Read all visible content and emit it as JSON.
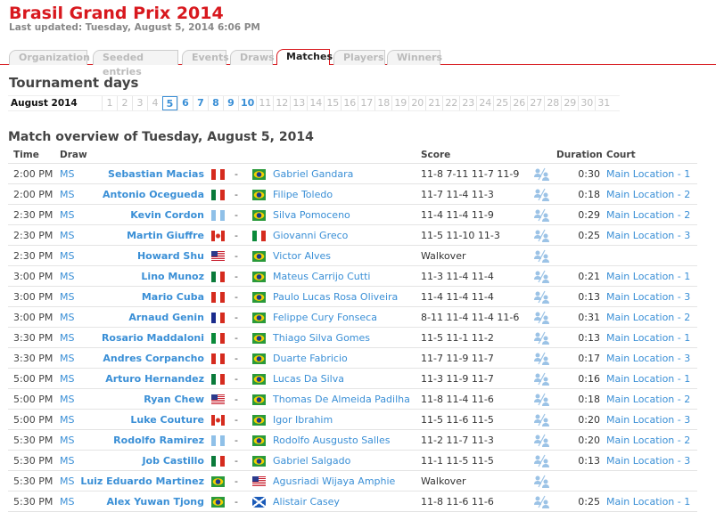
{
  "header": {
    "title": "Brasil Grand Prix 2014",
    "last_updated": "Last updated: Tuesday, August 5, 2014 6:06 PM"
  },
  "tabs": [
    {
      "label": "Organization"
    },
    {
      "label": "Seeded entries"
    },
    {
      "label": "Events"
    },
    {
      "label": "Draws"
    },
    {
      "label": "Matches",
      "active": true
    },
    {
      "label": "Players"
    },
    {
      "label": "Winners"
    }
  ],
  "days": {
    "heading": "Tournament days",
    "month": "August 2014",
    "selected": 5,
    "linked": [
      6,
      7,
      8,
      9,
      10
    ],
    "count": 31
  },
  "overview": {
    "heading": "Match overview of Tuesday, August 5, 2014",
    "columns": {
      "time": "Time",
      "draw": "Draw",
      "score": "Score",
      "duration": "Duration",
      "court": "Court"
    },
    "matches": [
      {
        "time": "2:00 PM",
        "draw": "MS",
        "p1": "Sebastian Macias",
        "f1": "pe",
        "p2": "Gabriel Gandara",
        "f2": "br",
        "score": "11-8 7-11 11-7 11-9",
        "duration": "0:30",
        "court": "Main Location - 1"
      },
      {
        "time": "2:00 PM",
        "draw": "MS",
        "p1": "Antonio Ocegueda",
        "f1": "mx",
        "p2": "Filipe Toledo",
        "f2": "br",
        "score": "11-7 11-4 11-3",
        "duration": "0:18",
        "court": "Main Location - 2"
      },
      {
        "time": "2:30 PM",
        "draw": "MS",
        "p1": "Kevin Cordon",
        "f1": "gt",
        "p2": "Silva Pomoceno",
        "f2": "br",
        "score": "11-4 11-4 11-9",
        "duration": "0:29",
        "court": "Main Location - 2"
      },
      {
        "time": "2:30 PM",
        "draw": "MS",
        "p1": "Martin Giuffre",
        "f1": "ca",
        "p2": "Giovanni Greco",
        "f2": "it",
        "score": "11-5 11-10 11-3",
        "duration": "0:25",
        "court": "Main Location - 3"
      },
      {
        "time": "2:30 PM",
        "draw": "MS",
        "p1": "Howard Shu",
        "f1": "us",
        "p2": "Victor Alves",
        "f2": "br",
        "score": "Walkover",
        "duration": "",
        "court": ""
      },
      {
        "time": "3:00 PM",
        "draw": "MS",
        "p1": "Lino Munoz",
        "f1": "mx",
        "p2": "Mateus Carrijo Cutti",
        "f2": "br",
        "score": "11-3 11-4 11-4",
        "duration": "0:21",
        "court": "Main Location - 1"
      },
      {
        "time": "3:00 PM",
        "draw": "MS",
        "p1": "Mario Cuba",
        "f1": "pe",
        "p2": "Paulo Lucas Rosa Oliveira",
        "f2": "br",
        "score": "11-4 11-4 11-4",
        "duration": "0:13",
        "court": "Main Location - 3"
      },
      {
        "time": "3:00 PM",
        "draw": "MS",
        "p1": "Arnaud Genin",
        "f1": "fr",
        "p2": "Felippe Cury Fonseca",
        "f2": "br",
        "score": "8-11 11-4 11-4 11-6",
        "duration": "0:31",
        "court": "Main Location - 2"
      },
      {
        "time": "3:30 PM",
        "draw": "MS",
        "p1": "Rosario Maddaloni",
        "f1": "it",
        "p2": "Thiago Silva Gomes",
        "f2": "br",
        "score": "11-5 11-1 11-2",
        "duration": "0:13",
        "court": "Main Location - 1"
      },
      {
        "time": "3:30 PM",
        "draw": "MS",
        "p1": "Andres Corpancho",
        "f1": "pe",
        "p2": "Duarte Fabricio",
        "f2": "br",
        "score": "11-7 11-9 11-7",
        "duration": "0:17",
        "court": "Main Location - 3"
      },
      {
        "time": "5:00 PM",
        "draw": "MS",
        "p1": "Arturo Hernandez",
        "f1": "mx",
        "p2": "Lucas Da Silva",
        "f2": "br",
        "score": "11-3 11-9 11-7",
        "duration": "0:16",
        "court": "Main Location - 1"
      },
      {
        "time": "5:00 PM",
        "draw": "MS",
        "p1": "Ryan Chew",
        "f1": "us",
        "p2": "Thomas De Almeida Padilha",
        "f2": "br",
        "score": "11-8 11-4 11-6",
        "duration": "0:18",
        "court": "Main Location - 2"
      },
      {
        "time": "5:00 PM",
        "draw": "MS",
        "p1": "Luke Couture",
        "f1": "ca",
        "p2": "Igor Ibrahim",
        "f2": "br",
        "score": "11-5 11-6 11-5",
        "duration": "0:20",
        "court": "Main Location - 3"
      },
      {
        "time": "5:30 PM",
        "draw": "MS",
        "p1": "Rodolfo Ramirez",
        "f1": "gt",
        "p2": "Rodolfo Ausgusto Salles",
        "f2": "br",
        "score": "11-2 11-7 11-3",
        "duration": "0:20",
        "court": "Main Location - 2"
      },
      {
        "time": "5:30 PM",
        "draw": "MS",
        "p1": "Job Castillo",
        "f1": "mx",
        "p2": "Gabriel Salgado",
        "f2": "br",
        "score": "11-1 11-5 11-5",
        "duration": "0:13",
        "court": "Main Location - 3"
      },
      {
        "time": "5:30 PM",
        "draw": "MS",
        "p1": "Luiz Eduardo Martinez",
        "f1": "br",
        "p2": "Agusriadi Wijaya Amphie",
        "f2": "us",
        "score": "Walkover",
        "duration": "",
        "court": ""
      },
      {
        "time": "5:30 PM",
        "draw": "MS",
        "p1": "Alex Yuwan Tjong",
        "f1": "br",
        "p2": "Alistair Casey",
        "f2": "sc",
        "score": "11-8 11-6 11-6",
        "duration": "0:25",
        "court": "Main Location - 1"
      }
    ]
  },
  "colors": {
    "brand": "#d8181e",
    "link": "#3a8fd6"
  }
}
